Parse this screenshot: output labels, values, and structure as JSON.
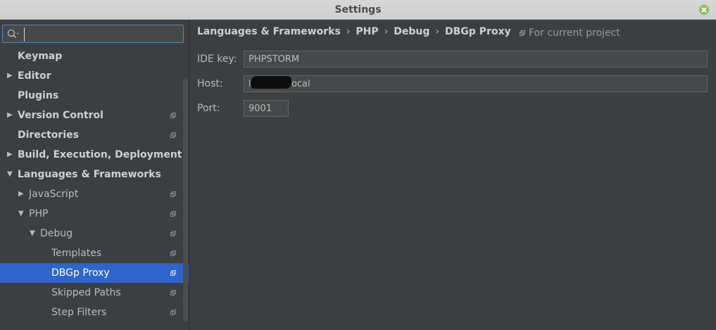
{
  "window": {
    "title": "Settings"
  },
  "search": {
    "value": "",
    "placeholder": ""
  },
  "sidebar": {
    "items": [
      {
        "label": "Keymap"
      },
      {
        "label": "Editor"
      },
      {
        "label": "Plugins"
      },
      {
        "label": "Version Control"
      },
      {
        "label": "Directories"
      },
      {
        "label": "Build, Execution, Deployment"
      },
      {
        "label": "Languages & Frameworks"
      },
      {
        "label": "JavaScript"
      },
      {
        "label": "PHP"
      },
      {
        "label": "Debug"
      },
      {
        "label": "Templates"
      },
      {
        "label": "DBGp Proxy"
      },
      {
        "label": "Skipped Paths"
      },
      {
        "label": "Step Filters"
      }
    ]
  },
  "breadcrumb": {
    "items": [
      "Languages & Frameworks",
      "PHP",
      "Debug",
      "DBGp Proxy"
    ],
    "separator": "›"
  },
  "scope_label": "For current project",
  "form": {
    "ide_key": {
      "label": "IDE key:",
      "value": "PHPSTORM"
    },
    "host": {
      "label": "Host:",
      "value": "l          2.local"
    },
    "port": {
      "label": "Port:",
      "value": "9001"
    }
  },
  "colors": {
    "selection": "#2f65ca",
    "background": "#3c3f41",
    "close_button": "#8bbf5a"
  }
}
